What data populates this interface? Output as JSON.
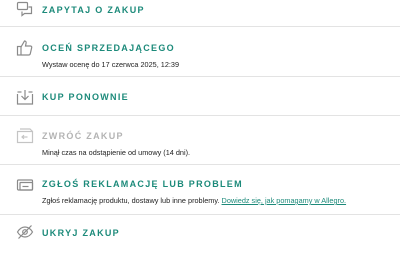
{
  "colors": {
    "accent": "#1c8a7a",
    "disabled": "#b3b3b3",
    "text": "#222222",
    "divider": "#e3e3e3",
    "icon": "#8a8a8a"
  },
  "actions": [
    {
      "key": "ask",
      "title": "ZAPYTAJ O ZAKUP",
      "icon": "chat-bubbles-icon"
    },
    {
      "key": "rate",
      "title": "OCEŃ SPRZEDAJĄCEGO",
      "description": "Wystaw ocenę do 17 czerwca 2025, 12:39",
      "icon": "thumbs-up-icon"
    },
    {
      "key": "rebuy",
      "title": "KUP PONOWNIE",
      "icon": "download-tray-icon"
    },
    {
      "key": "return",
      "title": "ZWRÓĆ ZAKUP",
      "description": "Minął czas na odstąpienie od umowy (14 dni).",
      "icon": "return-box-icon",
      "disabled": true
    },
    {
      "key": "complaint",
      "title": "ZGŁOŚ REKLAMACJĘ LUB PROBLEM",
      "description": "Zgłoś reklamację produktu, dostawy lub inne problemy.",
      "link": "Dowiedz się, jak pomagamy w Allegro.",
      "icon": "complaint-cards-icon"
    },
    {
      "key": "hide",
      "title": "UKRYJ ZAKUP",
      "icon": "eye-off-icon"
    }
  ]
}
